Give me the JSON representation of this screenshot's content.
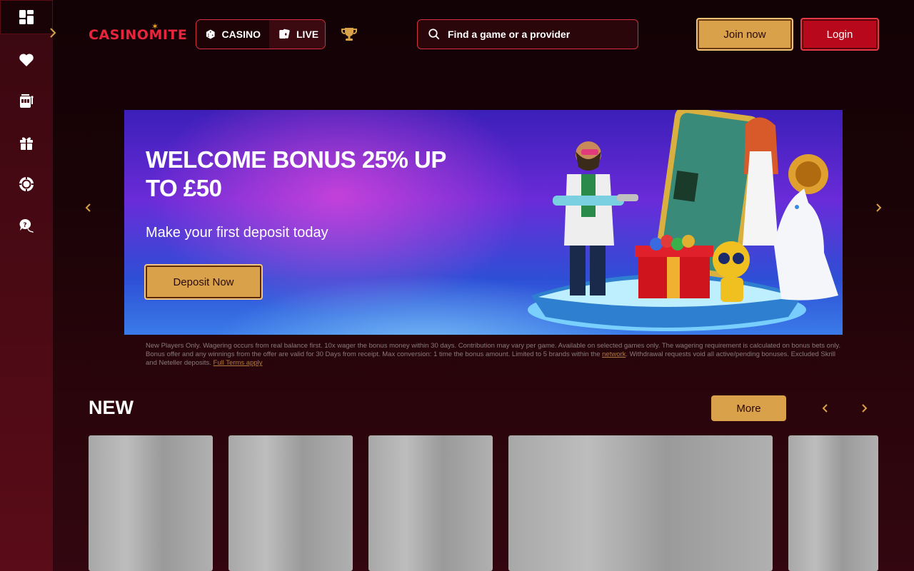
{
  "sidebar": {
    "items": [
      {
        "icon": "dashboard-icon"
      },
      {
        "icon": "heart-icon"
      },
      {
        "icon": "slot-machine-icon"
      },
      {
        "icon": "gift-icon"
      },
      {
        "icon": "poker-chip-icon"
      },
      {
        "icon": "help-chat-icon"
      }
    ],
    "toggle_icon": "chevron-right-icon"
  },
  "header": {
    "logo": "CASINOMITE",
    "modes": [
      {
        "label": "CASINO",
        "icon": "dice-icon"
      },
      {
        "label": "LIVE",
        "icon": "cards-icon"
      }
    ],
    "search_placeholder": "Find a game or a provider",
    "join_label": "Join now",
    "login_label": "Login"
  },
  "banner": {
    "title": "WELCOME BONUS 25% UP TO £50",
    "subtitle": "Make your first deposit today",
    "cta_label": "Deposit Now",
    "disclaimer_part1": "New Players Only. Wagering occurs from real balance first. 10x wager the bonus money within 30 days. Contribution may vary per game. Available on selected games only. The wagering requirement is calculated on bonus bets only. Bonus offer and any winnings from the offer are valid for 30 Days from receipt. Max conversion: 1 time the bonus amount. Limited to 5 brands within the ",
    "disclaimer_link1": "network",
    "disclaimer_part2": ". Withdrawal requests void all active/pending bonuses. Excluded Skrill and Neteller deposits. ",
    "disclaimer_link2": "Full Terms apply"
  },
  "new_section": {
    "title": "NEW",
    "more_label": "More"
  },
  "colors": {
    "brand_red": "#e8253b",
    "gold": "#d9a14a",
    "login_red": "#b8091c"
  }
}
